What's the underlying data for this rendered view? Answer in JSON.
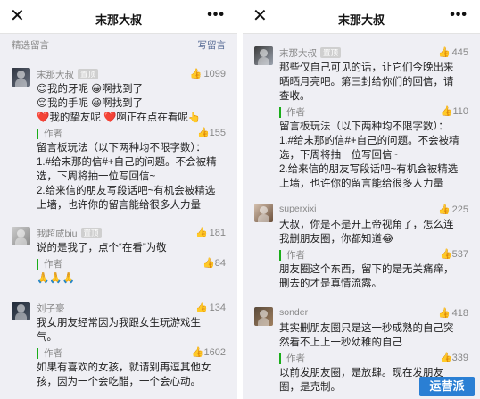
{
  "left": {
    "header": {
      "close_glyph": "✕",
      "title": "末那大叔",
      "more_glyph": "•••"
    },
    "section": {
      "label": "精选留言",
      "write_label": "写留言"
    },
    "comments": [
      {
        "nickname": "末那大叔",
        "badge": "置顶",
        "likes": "1099",
        "lines": [
          "😊我的牙呢 😀啊找到了",
          "😌我的手呢 😆啊找到了",
          "❤️我的挚友呢 ❤️啊正在点在看呢👆"
        ],
        "reply_author": "作者",
        "reply_likes": "155",
        "reply_lines": [
          "留言板玩法（以下两种均不限字数）：",
          "1.#给末那的信#+自己的问题。不会被精",
          "选，下周将抽一位写回信~",
          "2.给来信的朋友写段话吧~有机会被精选",
          "上墙，也许你的留言能给很多人力量"
        ]
      },
      {
        "nickname": "我超咸biu",
        "badge": "置顶",
        "likes": "181",
        "lines": [
          "说的是我了，点个“在看”为敬"
        ],
        "reply_author": "作者",
        "reply_likes": "84",
        "reply_lines": [
          "🙏🙏🙏"
        ]
      },
      {
        "nickname": "刘子豪",
        "badge": "",
        "likes": "134",
        "lines": [
          "我女朋友经常因为我跟女生玩游戏生",
          "气。"
        ],
        "reply_author": "作者",
        "reply_likes": "1602",
        "reply_lines": [
          "如果有喜欢的女孩，就请别再逗其他女",
          "孩，因为一个会吃醋，一个会心动。"
        ]
      }
    ]
  },
  "right": {
    "header": {
      "close_glyph": "✕",
      "title": "末那大叔",
      "more_glyph": "•••"
    },
    "comments": [
      {
        "nickname": "末那大叔",
        "badge": "置顶",
        "likes": "445",
        "lines": [
          "那些仅自己可见的话，让它们今晚出来",
          "晒晒月亮吧。第三封给你们的回信，请",
          "查收。"
        ],
        "reply_author": "作者",
        "reply_likes": "110",
        "reply_lines": [
          "留言板玩法（以下两种均不限字数）：",
          "1.#给末那的信#+自己的问题。不会被精",
          "选，下周将抽一位写回信~",
          "2.给来信的朋友写段话吧~有机会被精选",
          "上墙，也许你的留言能给很多人力量"
        ]
      },
      {
        "nickname": "superxixi",
        "badge": "",
        "likes": "225",
        "lines": [
          "大叔，你是不是开上帝视角了，怎么连",
          "我删朋友圈，你都知道😂"
        ],
        "reply_author": "作者",
        "reply_likes": "537",
        "reply_lines": [
          "朋友圈这个东西，留下的是无关痛痒，",
          "删去的才是真情流露。"
        ]
      },
      {
        "nickname": "sonder",
        "badge": "",
        "likes": "418",
        "lines": [
          "其实删朋友圈只是这一秒成熟的自己突",
          "然看不上上一秒幼稚的自己"
        ],
        "reply_author": "作者",
        "reply_likes": "339",
        "reply_lines": [
          "以前发朋友圈，是放肆。现在发朋友",
          "圈，是克制。"
        ]
      }
    ],
    "watermark": "运营派"
  },
  "icons": {
    "like": "thumb-up-icon",
    "close": "close-icon",
    "more": "more-icon"
  }
}
